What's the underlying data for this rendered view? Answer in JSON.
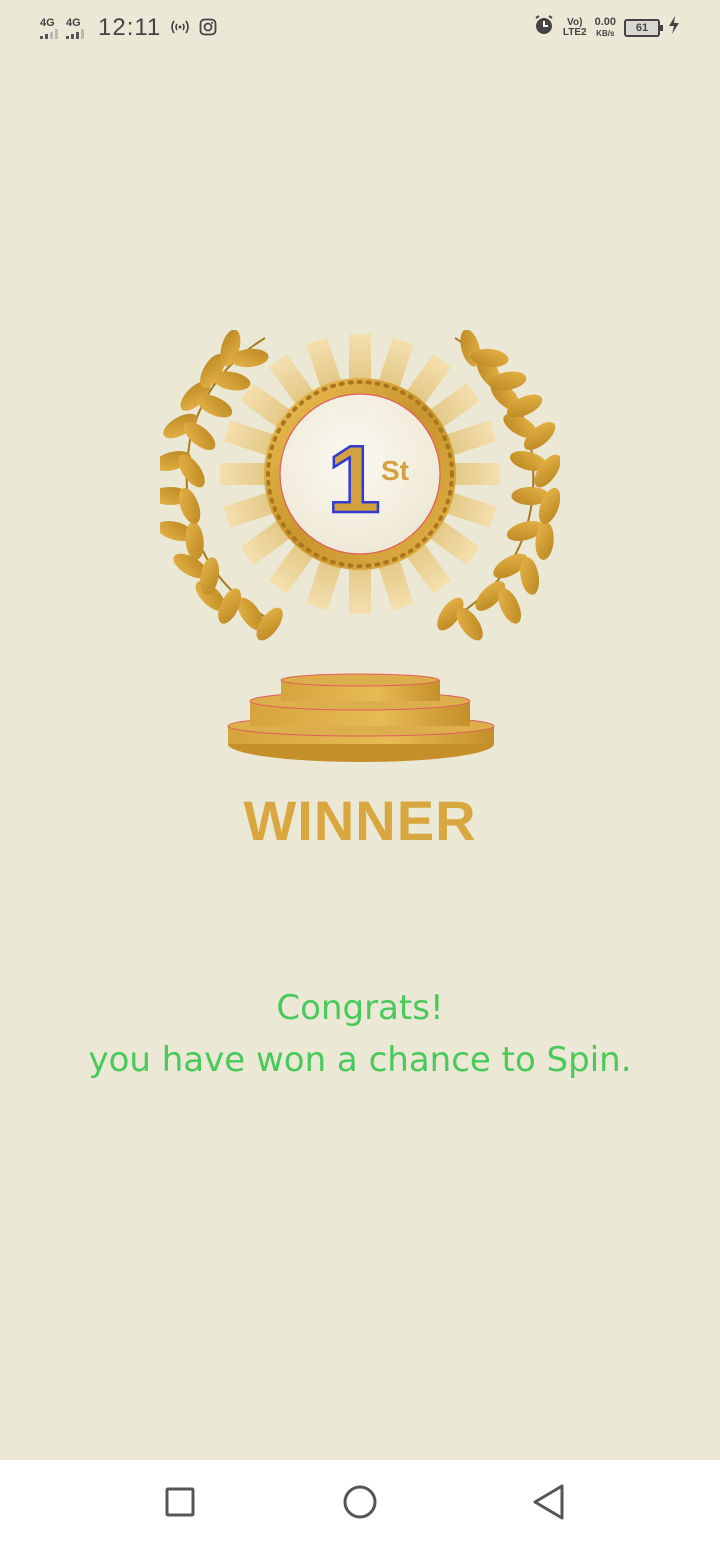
{
  "status_bar": {
    "net1": "4G",
    "net2": "4G",
    "time": "12:11",
    "hotspot_icon": "hotspot-icon",
    "instagram_icon": "instagram-icon",
    "alarm_icon": "alarm-icon",
    "volte": "Vo)",
    "lte": "LTE2",
    "speed": "0.00",
    "speed_unit": "KB/s",
    "battery": "61",
    "charging_icon": "charging-icon"
  },
  "award": {
    "place_number": "1",
    "place_suffix": "St",
    "title": "WINNER"
  },
  "message": {
    "line1": "Congrats!",
    "line2": "you have won a chance to Spin."
  },
  "colors": {
    "background": "#ece8d6",
    "gold": "#d9a73f",
    "message_green": "#48c95a"
  },
  "nav_bar": {
    "recents_icon": "square-icon",
    "home_icon": "circle-icon",
    "back_icon": "triangle-back-icon"
  }
}
